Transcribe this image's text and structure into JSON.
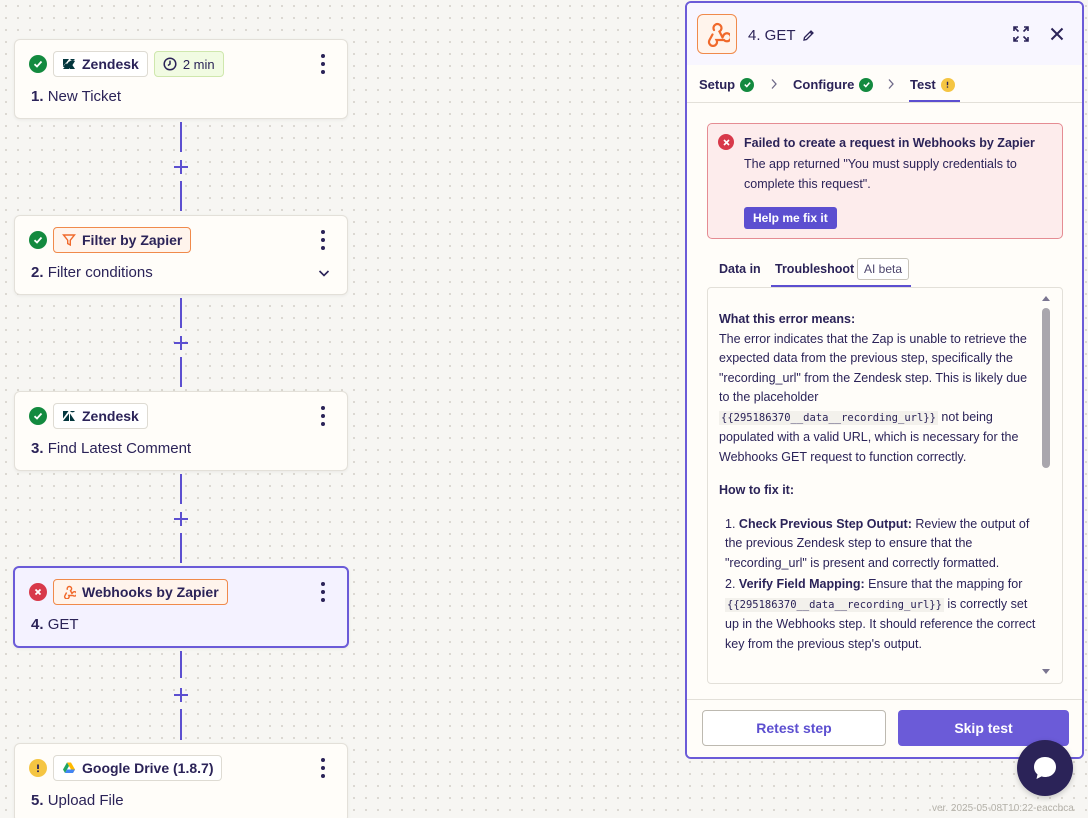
{
  "canvas": {
    "steps": [
      {
        "status": "success",
        "app": "Zendesk",
        "badge": "2 min",
        "number": "1.",
        "title": "New Ticket"
      },
      {
        "status": "success",
        "app": "Filter by Zapier",
        "number": "2.",
        "title": "Filter conditions"
      },
      {
        "status": "success",
        "app": "Zendesk",
        "number": "3.",
        "title": "Find Latest Comment"
      },
      {
        "status": "error",
        "app": "Webhooks by Zapier",
        "number": "4.",
        "title": "GET"
      },
      {
        "status": "warning",
        "app": "Google Drive (1.8.7)",
        "number": "5.",
        "title": "Upload File"
      }
    ]
  },
  "panel": {
    "title": "4. GET",
    "tabs": [
      {
        "label": "Setup",
        "status": "success"
      },
      {
        "label": "Configure",
        "status": "success"
      },
      {
        "label": "Test",
        "status": "warning"
      }
    ],
    "error": {
      "title": "Failed to create a request in Webhooks by Zapier",
      "message": "The app returned \"You must supply credentials to complete this request\".",
      "help_button": "Help me fix it"
    },
    "subtabs": {
      "data_in": "Data in",
      "troubleshoot": "Troubleshoot",
      "ai_badge": "AI beta"
    },
    "troubleshoot": {
      "meaning_heading": "What this error means:",
      "meaning_text_1": "The error indicates that the Zap is unable to retrieve the expected data from the previous step, specifically the \"recording_url\" from the Zendesk step. This is likely due to the placeholder ",
      "meaning_code": "{{295186370__data__recording_url}}",
      "meaning_text_2": " not being populated with a valid URL, which is necessary for the Webhooks GET request to function correctly.",
      "fix_heading": "How to fix it:",
      "fix_steps": [
        {
          "num": "1.",
          "title": "Check Previous Step Output:",
          "text": " Review the output of the previous Zendesk step to ensure that the \"recording_url\" is present and correctly formatted."
        },
        {
          "num": "2.",
          "title": "Verify Field Mapping:",
          "text_1": " Ensure that the mapping for ",
          "code": "{{295186370__data__recording_url}}",
          "text_2": " is correctly set up in the Webhooks step. It should reference the correct key from the previous step's output."
        }
      ]
    },
    "footer": {
      "retest_label": "Retest step",
      "skip_label": "Skip test"
    }
  },
  "version": "ver. 2025-05-08T10:22-eaccbca",
  "colors": {
    "accent": "#6b5bd8",
    "success": "#138a3f",
    "error": "#d8394a",
    "warning": "#f5c542",
    "text": "#2b2358"
  }
}
